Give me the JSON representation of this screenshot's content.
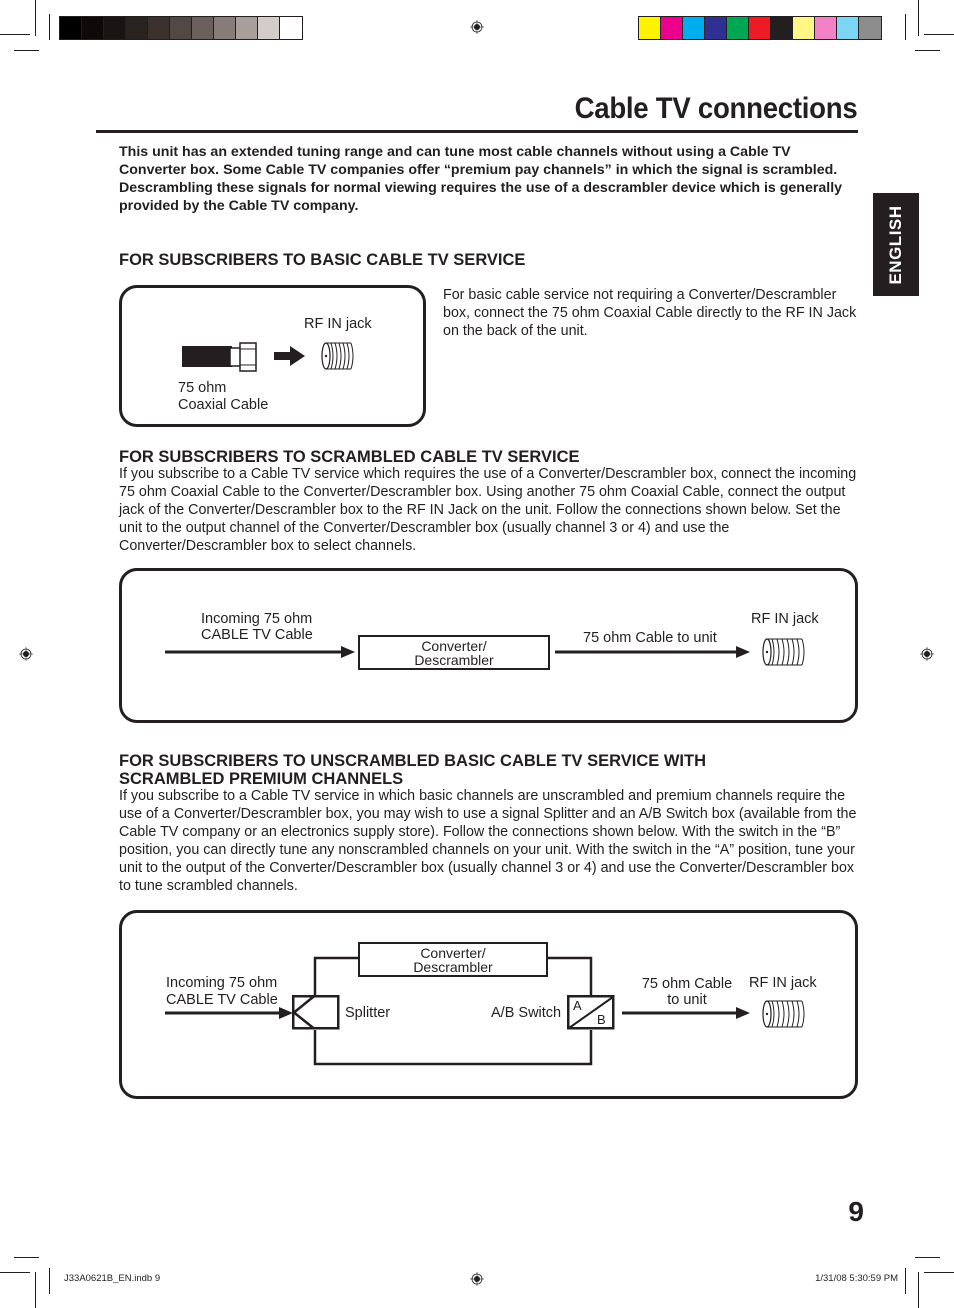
{
  "page": {
    "title": "Cable TV connections",
    "language_tab": "ENGLISH",
    "page_number": "9",
    "intro": "This unit has an extended tuning range and can tune most cable channels without using a Cable TV Converter box. Some Cable TV companies offer “premium pay channels” in which the signal is scrambled. Descrambling these signals for normal viewing requires the use of a descrambler device which is generally provided by the Cable TV company."
  },
  "color_bars": {
    "grayscale": [
      "#000000",
      "#0d0a09",
      "#1a1515",
      "#2a2421",
      "#3b3230",
      "#524846",
      "#6b605d",
      "#877c79",
      "#a89f9c",
      "#d4cccb",
      "#ffffff"
    ],
    "process": [
      "#fff200",
      "#ec008c",
      "#00aeef",
      "#2e3192",
      "#00a651",
      "#ed1c24",
      "#231f20",
      "#fff685",
      "#f282c5",
      "#7dd5f6",
      "#8c8c8c"
    ]
  },
  "sections": [
    {
      "heading": "FOR SUBSCRIBERS TO BASIC CABLE TV SERVICE",
      "body": "For basic cable service not requiring a Converter/Descrambler box, connect the 75 ohm Coaxial Cable directly to the RF IN Jack on the back of the unit.",
      "diagram": {
        "rf_label": "RF IN jack",
        "cable_label_1": "75 ohm",
        "cable_label_2": "Coaxial Cable"
      }
    },
    {
      "heading": "FOR SUBSCRIBERS TO SCRAMBLED CABLE TV SERVICE",
      "body": "If you subscribe to a Cable TV service which requires the use of a Converter/Descrambler box, connect the incoming 75 ohm Coaxial Cable to the Converter/Descrambler box. Using another 75 ohm Coaxial Cable, connect the output jack of the Converter/Descrambler box to the RF IN Jack on the unit. Follow the connections shown below. Set the unit to the output channel of the Converter/Descrambler box (usually channel 3 or 4) and use the Converter/Descrambler box to select channels.",
      "diagram": {
        "incoming_1": "Incoming 75 ohm",
        "incoming_2": "CABLE TV Cable",
        "converter_1": "Converter/",
        "converter_2": "Descrambler",
        "cable_to_unit": "75 ohm Cable to unit",
        "rf_label": "RF IN jack"
      }
    },
    {
      "heading_1": "FOR SUBSCRIBERS TO UNSCRAMBLED BASIC CABLE TV SERVICE WITH",
      "heading_2": "SCRAMBLED PREMIUM CHANNELS",
      "body": "If you subscribe to a Cable TV service in which basic channels are unscrambled and premium channels require the use of a Converter/Descrambler box, you may wish to use a signal Splitter and an A/B Switch box (available from the Cable TV company or an electronics supply store). Follow the connections shown below. With the switch in the “B” position, you can directly tune any nonscrambled channels on your unit. With the switch in the “A” position, tune your unit to the output of the Converter/Descrambler box (usually channel 3 or 4) and use the Converter/Descrambler box to tune scrambled channels.",
      "diagram": {
        "incoming_1": "Incoming 75 ohm",
        "incoming_2": "CABLE TV Cable",
        "converter_1": "Converter/",
        "converter_2": "Descrambler",
        "splitter": "Splitter",
        "ab_switch": "A/B Switch",
        "switch_a": "A",
        "switch_b": "B",
        "cable_to_unit_1": "75 ohm Cable",
        "cable_to_unit_2": "to unit",
        "rf_label": "RF IN jack"
      }
    }
  ],
  "slug": {
    "file": "J33A0621B_EN.indb   9",
    "timestamp": "1/31/08   5:30:59 PM"
  }
}
